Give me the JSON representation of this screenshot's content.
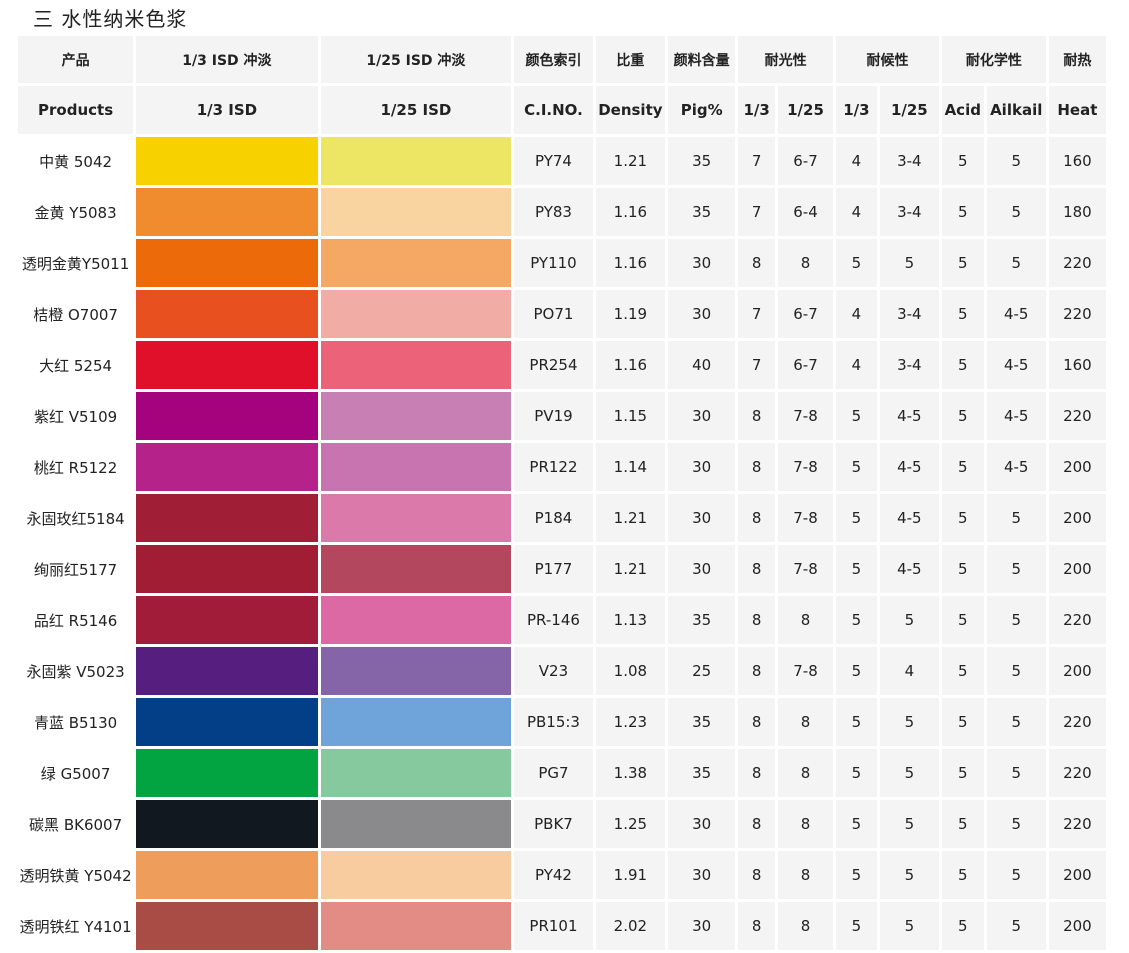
{
  "page_title": "三 水性纳米色浆",
  "header_cn": {
    "product": "产品",
    "tint_13": "1/3 ISD 冲淡",
    "tint_125": "1/25 ISD 冲淡",
    "color_index": "颜色索引",
    "density": "比重",
    "pigment": "颜料含量",
    "light": "耐光性",
    "weather": "耐候性",
    "chemical": "耐化学性",
    "heat": "耐热"
  },
  "header_en": {
    "product": "Products",
    "tint_13": "1/3 ISD",
    "tint_125": "1/25 ISD",
    "color_index": "C.I.NO.",
    "density": "Density",
    "pigment": "Pig%",
    "light_13": "1/3",
    "light_125": "1/25",
    "weather_13": "1/3",
    "weather_125": "1/25",
    "acid": "Acid",
    "alkali": "Ailkail",
    "heat": "Heat"
  },
  "rows": [
    {
      "name": "中黄 5042",
      "c1": "#f7d100",
      "c2": "#ede564",
      "ci": "PY74",
      "density": "1.21",
      "pig": "35",
      "l13": "7",
      "l125": "6-7",
      "w13": "4",
      "w125": "3-4",
      "acid": "5",
      "alkali": "5",
      "heat": "160"
    },
    {
      "name": "金黄 Y5083",
      "c1": "#f08b2e",
      "c2": "#f9d3a0",
      "ci": "PY83",
      "density": "1.16",
      "pig": "35",
      "l13": "7",
      "l125": "6-4",
      "w13": "4",
      "w125": "3-4",
      "acid": "5",
      "alkali": "5",
      "heat": "180"
    },
    {
      "name": "透明金黄Y5011",
      "c1": "#ec6a0a",
      "c2": "#f4a864",
      "ci": "PY110",
      "density": "1.16",
      "pig": "30",
      "l13": "8",
      "l125": "8",
      "w13": "5",
      "w125": "5",
      "acid": "5",
      "alkali": "5",
      "heat": "220"
    },
    {
      "name": "桔橙 O7007",
      "c1": "#e8501f",
      "c2": "#f2aca6",
      "ci": "PO71",
      "density": "1.19",
      "pig": "30",
      "l13": "7",
      "l125": "6-7",
      "w13": "4",
      "w125": "3-4",
      "acid": "5",
      "alkali": "4-5",
      "heat": "220"
    },
    {
      "name": "大红 5254",
      "c1": "#e00f2a",
      "c2": "#ec6278",
      "ci": "PR254",
      "density": "1.16",
      "pig": "40",
      "l13": "7",
      "l125": "6-7",
      "w13": "4",
      "w125": "3-4",
      "acid": "5",
      "alkali": "4-5",
      "heat": "160"
    },
    {
      "name": "紫红 V5109",
      "c1": "#a5037e",
      "c2": "#c77fb4",
      "ci": "PV19",
      "density": "1.15",
      "pig": "30",
      "l13": "8",
      "l125": "7-8",
      "w13": "5",
      "w125": "4-5",
      "acid": "5",
      "alkali": "4-5",
      "heat": "220"
    },
    {
      "name": "桃红 R5122",
      "c1": "#b5238a",
      "c2": "#c874b0",
      "ci": "PR122",
      "density": "1.14",
      "pig": "30",
      "l13": "8",
      "l125": "7-8",
      "w13": "5",
      "w125": "4-5",
      "acid": "5",
      "alkali": "4-5",
      "heat": "200"
    },
    {
      "name": "永固玫红5184",
      "c1": "#a01e36",
      "c2": "#dc79ab",
      "ci": "P184",
      "density": "1.21",
      "pig": "30",
      "l13": "8",
      "l125": "7-8",
      "w13": "5",
      "w125": "4-5",
      "acid": "5",
      "alkali": "5",
      "heat": "200"
    },
    {
      "name": "绚丽红5177",
      "c1": "#a11d34",
      "c2": "#b2475d",
      "ci": "P177",
      "density": "1.21",
      "pig": "30",
      "l13": "8",
      "l125": "7-8",
      "w13": "5",
      "w125": "4-5",
      "acid": "5",
      "alkali": "5",
      "heat": "200"
    },
    {
      "name": "品红 R5146",
      "c1": "#a11c38",
      "c2": "#dc68a4",
      "ci": "PR-146",
      "density": "1.13",
      "pig": "35",
      "l13": "8",
      "l125": "8",
      "w13": "5",
      "w125": "5",
      "acid": "5",
      "alkali": "5",
      "heat": "220"
    },
    {
      "name": "永固紫 V5023",
      "c1": "#561e7e",
      "c2": "#8565a8",
      "ci": "V23",
      "density": "1.08",
      "pig": "25",
      "l13": "8",
      "l125": "7-8",
      "w13": "5",
      "w125": "4",
      "acid": "5",
      "alkali": "5",
      "heat": "200"
    },
    {
      "name": "青蓝 B5130",
      "c1": "#033f87",
      "c2": "#6ea4d9",
      "ci": "PB15:3",
      "density": "1.23",
      "pig": "35",
      "l13": "8",
      "l125": "8",
      "w13": "5",
      "w125": "5",
      "acid": "5",
      "alkali": "5",
      "heat": "220"
    },
    {
      "name": "绿 G5007",
      "c1": "#02a441",
      "c2": "#86c99f",
      "ci": "PG7",
      "density": "1.38",
      "pig": "35",
      "l13": "8",
      "l125": "8",
      "w13": "5",
      "w125": "5",
      "acid": "5",
      "alkali": "5",
      "heat": "220"
    },
    {
      "name": "碳黑 BK6007",
      "c1": "#121820",
      "c2": "#8a8a8c",
      "ci": "PBK7",
      "density": "1.25",
      "pig": "30",
      "l13": "8",
      "l125": "8",
      "w13": "5",
      "w125": "5",
      "acid": "5",
      "alkali": "5",
      "heat": "220"
    },
    {
      "name": "透明铁黄 Y5042",
      "c1": "#ef9d5b",
      "c2": "#f9cc9f",
      "ci": "PY42",
      "density": "1.91",
      "pig": "30",
      "l13": "8",
      "l125": "8",
      "w13": "5",
      "w125": "5",
      "acid": "5",
      "alkali": "5",
      "heat": "200"
    },
    {
      "name": "透明铁红 Y4101",
      "c1": "#a84c45",
      "c2": "#e38c86",
      "ci": "PR101",
      "density": "2.02",
      "pig": "30",
      "l13": "8",
      "l125": "8",
      "w13": "5",
      "w125": "5",
      "acid": "5",
      "alkali": "5",
      "heat": "200"
    }
  ]
}
